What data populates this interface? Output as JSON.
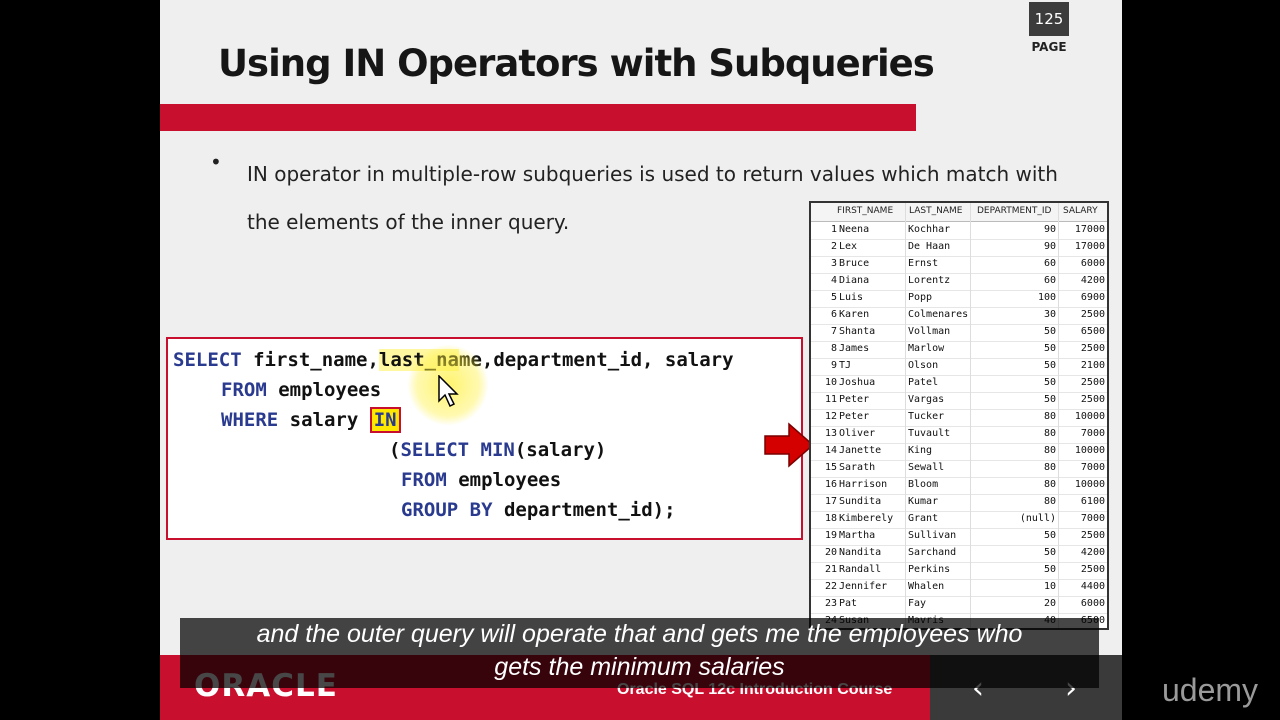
{
  "slide": {
    "page_number": "125",
    "page_label": "PAGE",
    "title": "Using IN Operators with Subqueries",
    "bullet": "IN operator in multiple-row subqueries is used to return values which match with the elements of the inner query."
  },
  "code": {
    "line1_kw": "SELECT",
    "line1_rest_a": " first_name,",
    "line1_hl": "last_na",
    "line1_rest_b": "me,department_id, salary",
    "line2_kw": "FROM",
    "line2_rest": " employees",
    "line3_kw": "WHERE",
    "line3_rest": " salary ",
    "line3_in": "IN",
    "line4_open": "(",
    "line4_kw": "SELECT MIN",
    "line4_rest": "(salary)",
    "line5_kw": "FROM",
    "line5_rest": " employees",
    "line6_kw": "GROUP BY",
    "line6_rest": " department_id);"
  },
  "table": {
    "headers": [
      "FIRST_NAME",
      "LAST_NAME",
      "DEPARTMENT_ID",
      "SALARY"
    ],
    "rows": [
      {
        "n": "1",
        "first": "Neena",
        "last": "Kochhar",
        "dept": "90",
        "salary": "17000"
      },
      {
        "n": "2",
        "first": "Lex",
        "last": "De Haan",
        "dept": "90",
        "salary": "17000"
      },
      {
        "n": "3",
        "first": "Bruce",
        "last": "Ernst",
        "dept": "60",
        "salary": "6000"
      },
      {
        "n": "4",
        "first": "Diana",
        "last": "Lorentz",
        "dept": "60",
        "salary": "4200"
      },
      {
        "n": "5",
        "first": "Luis",
        "last": "Popp",
        "dept": "100",
        "salary": "6900"
      },
      {
        "n": "6",
        "first": "Karen",
        "last": "Colmenares",
        "dept": "30",
        "salary": "2500"
      },
      {
        "n": "7",
        "first": "Shanta",
        "last": "Vollman",
        "dept": "50",
        "salary": "6500"
      },
      {
        "n": "8",
        "first": "James",
        "last": "Marlow",
        "dept": "50",
        "salary": "2500"
      },
      {
        "n": "9",
        "first": "TJ",
        "last": "Olson",
        "dept": "50",
        "salary": "2100"
      },
      {
        "n": "10",
        "first": "Joshua",
        "last": "Patel",
        "dept": "50",
        "salary": "2500"
      },
      {
        "n": "11",
        "first": "Peter",
        "last": "Vargas",
        "dept": "50",
        "salary": "2500"
      },
      {
        "n": "12",
        "first": "Peter",
        "last": "Tucker",
        "dept": "80",
        "salary": "10000"
      },
      {
        "n": "13",
        "first": "Oliver",
        "last": "Tuvault",
        "dept": "80",
        "salary": "7000"
      },
      {
        "n": "14",
        "first": "Janette",
        "last": "King",
        "dept": "80",
        "salary": "10000"
      },
      {
        "n": "15",
        "first": "Sarath",
        "last": "Sewall",
        "dept": "80",
        "salary": "7000"
      },
      {
        "n": "16",
        "first": "Harrison",
        "last": "Bloom",
        "dept": "80",
        "salary": "10000"
      },
      {
        "n": "17",
        "first": "Sundita",
        "last": "Kumar",
        "dept": "80",
        "salary": "6100"
      },
      {
        "n": "18",
        "first": "Kimberely",
        "last": "Grant",
        "dept": "(null)",
        "salary": "7000"
      },
      {
        "n": "19",
        "first": "Martha",
        "last": "Sullivan",
        "dept": "50",
        "salary": "2500"
      },
      {
        "n": "20",
        "first": "Nandita",
        "last": "Sarchand",
        "dept": "50",
        "salary": "4200"
      },
      {
        "n": "21",
        "first": "Randall",
        "last": "Perkins",
        "dept": "50",
        "salary": "2500"
      },
      {
        "n": "22",
        "first": "Jennifer",
        "last": "Whalen",
        "dept": "10",
        "salary": "4400"
      },
      {
        "n": "23",
        "first": "Pat",
        "last": "Fay",
        "dept": "20",
        "salary": "6000"
      },
      {
        "n": "24",
        "first": "Susan",
        "last": "Mavris",
        "dept": "40",
        "salary": "6500"
      }
    ]
  },
  "footer": {
    "brand": "ORACLE",
    "course": "Oracle SQL 12c Introduction Course",
    "prev_icon": "chevron-left-icon",
    "next_icon": "chevron-right-icon"
  },
  "subtitle": {
    "line1": "and the outer query will operate that and gets me the employees who",
    "line2": "gets the minimum salaries"
  },
  "player": {
    "brand": "udemy"
  },
  "colors": {
    "accent_red": "#c8102e",
    "keyword_blue": "#2a3b8f",
    "highlight_yellow": "#ffe800"
  }
}
